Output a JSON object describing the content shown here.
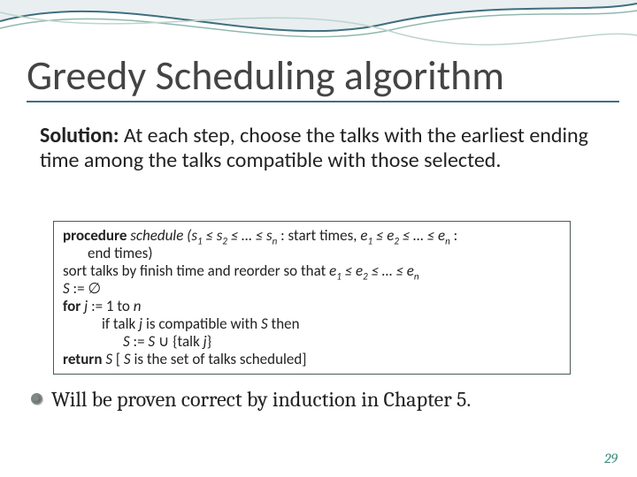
{
  "title": "Greedy Scheduling algorithm",
  "solution_label": "Solution:",
  "solution_text": " At each step, choose the talks with the earliest ending time among the talks compatible with those selected.",
  "code": {
    "proc_kw": "procedure",
    "proc_name": " schedule (",
    "proc_args_pre": "s",
    "proc_rel": " ≤ ",
    "ellipsis": " … ",
    "start_label": " : start times, ",
    "e": "e",
    "end_label_head": " :",
    "end_label_indent": "end times)",
    "line_sort": "sort talks by finish time and reorder so that ",
    "line_S0": "S := ∅",
    "for_kw": "for ",
    "for_rest": "j := 1 to n",
    "if_line": "if talk j is compatible with S then",
    "assign_line": "S := S ∪ {talk j}",
    "return_kw": "return",
    "return_rest": " S [ S is the set of talks scheduled]"
  },
  "bullet": "Will be proven correct by induction in Chapter 5.",
  "page": "29"
}
